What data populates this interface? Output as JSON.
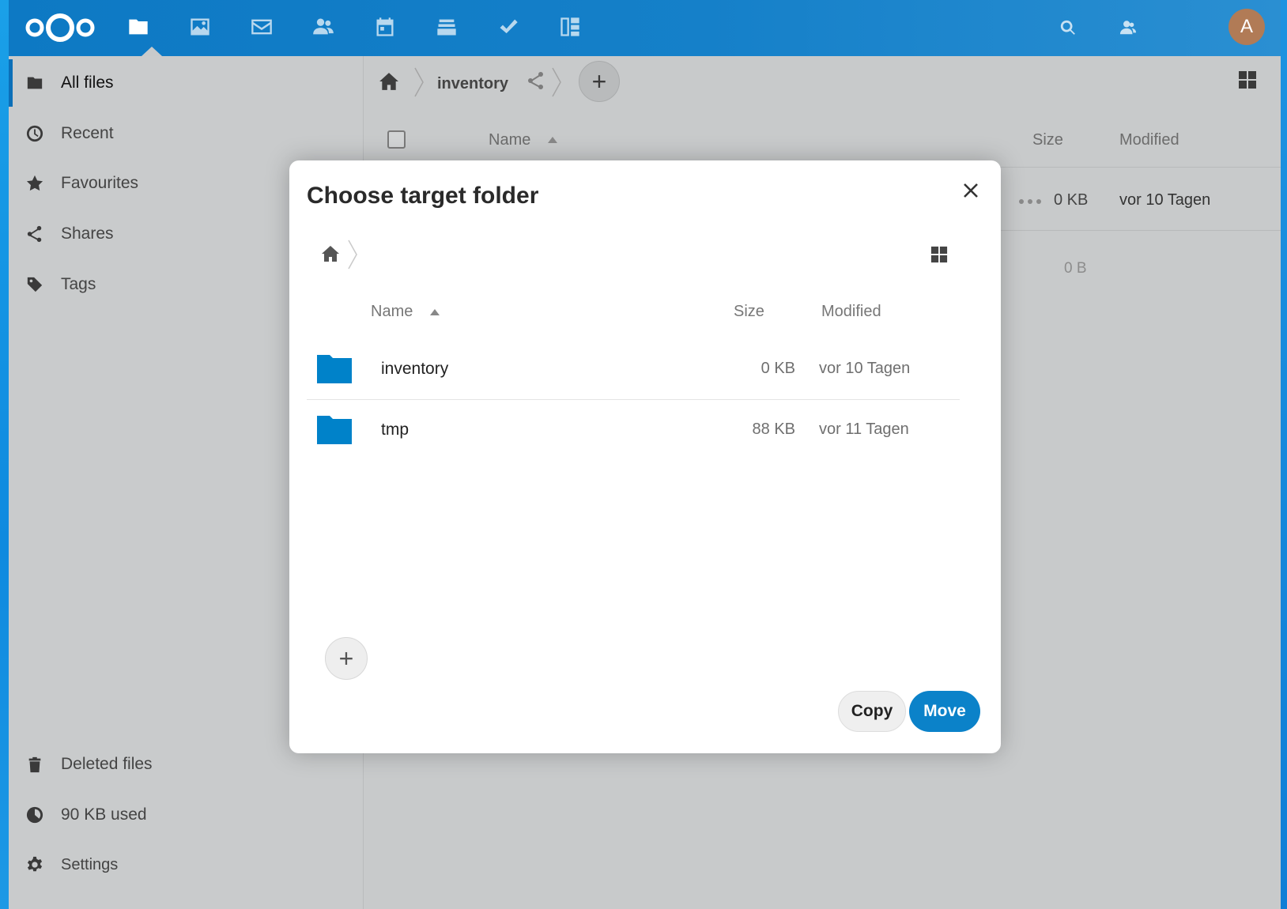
{
  "header": {
    "apps": [
      {
        "name": "files-app-icon"
      },
      {
        "name": "photos-app-icon"
      },
      {
        "name": "mail-app-icon"
      },
      {
        "name": "contacts-app-icon"
      },
      {
        "name": "calendar-app-icon"
      },
      {
        "name": "notes-app-icon"
      },
      {
        "name": "tasks-app-icon"
      },
      {
        "name": "deck-app-icon"
      }
    ],
    "avatar_initial": "A"
  },
  "sidebar": {
    "items": [
      {
        "label": "All files"
      },
      {
        "label": "Recent"
      },
      {
        "label": "Favourites"
      },
      {
        "label": "Shares"
      },
      {
        "label": "Tags"
      }
    ],
    "deleted_label": "Deleted files",
    "quota_label": "90 KB used",
    "settings_label": "Settings"
  },
  "main": {
    "breadcrumb_folder": "inventory",
    "columns": {
      "name": "Name",
      "size": "Size",
      "modified": "Modified"
    },
    "rows": [
      {
        "size": "0 KB",
        "modified": "vor 10 Tagen"
      }
    ],
    "summary_size": "0 B"
  },
  "dialog": {
    "title": "Choose target folder",
    "columns": {
      "name": "Name",
      "size": "Size",
      "modified": "Modified"
    },
    "folders": [
      {
        "name": "inventory",
        "size": "0 KB",
        "modified": "vor 10 Tagen"
      },
      {
        "name": "tmp",
        "size": "88 KB",
        "modified": "vor 11 Tagen"
      }
    ],
    "copy_label": "Copy",
    "move_label": "Move",
    "folder_color": "#0082c9"
  }
}
